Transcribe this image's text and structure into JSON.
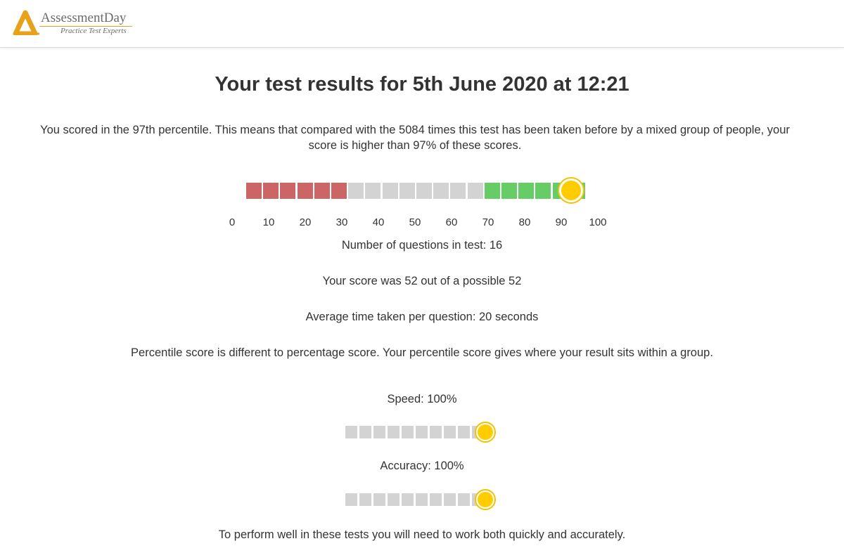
{
  "brand": {
    "name": "AssessmentDay",
    "tagline": "Practice Test Experts",
    "accent_color": "#e8a21a"
  },
  "results": {
    "title": "Your test results for 5th June 2020 at 12:21",
    "intro": "You scored in the 97th percentile. This means that compared with the 5084 times this test has been taken before by a mixed group of people, your score is higher than 97% of these scores.",
    "percentile_value": 97,
    "scale_labels": [
      "0",
      "10",
      "20",
      "30",
      "40",
      "50",
      "60",
      "70",
      "80",
      "90",
      "100"
    ],
    "scale_colors": {
      "low": "#cc6666",
      "mid": "#d3d3d3",
      "high": "#66cc66",
      "marker": "#ffcc00"
    },
    "questions": "Number of questions in test: 16",
    "score": "Your score was 52 out of a possible 52",
    "avg_time": "Average time taken per question: 20 seconds",
    "note": "Percentile score is different to percentage score. Your percentile score gives where your result sits within a group.",
    "speed": {
      "label": "Speed: 100%",
      "value": 100
    },
    "accuracy": {
      "label": "Accuracy: 100%",
      "value": 100
    },
    "advice": "To perform well in these tests you will need to work both quickly and accurately."
  }
}
